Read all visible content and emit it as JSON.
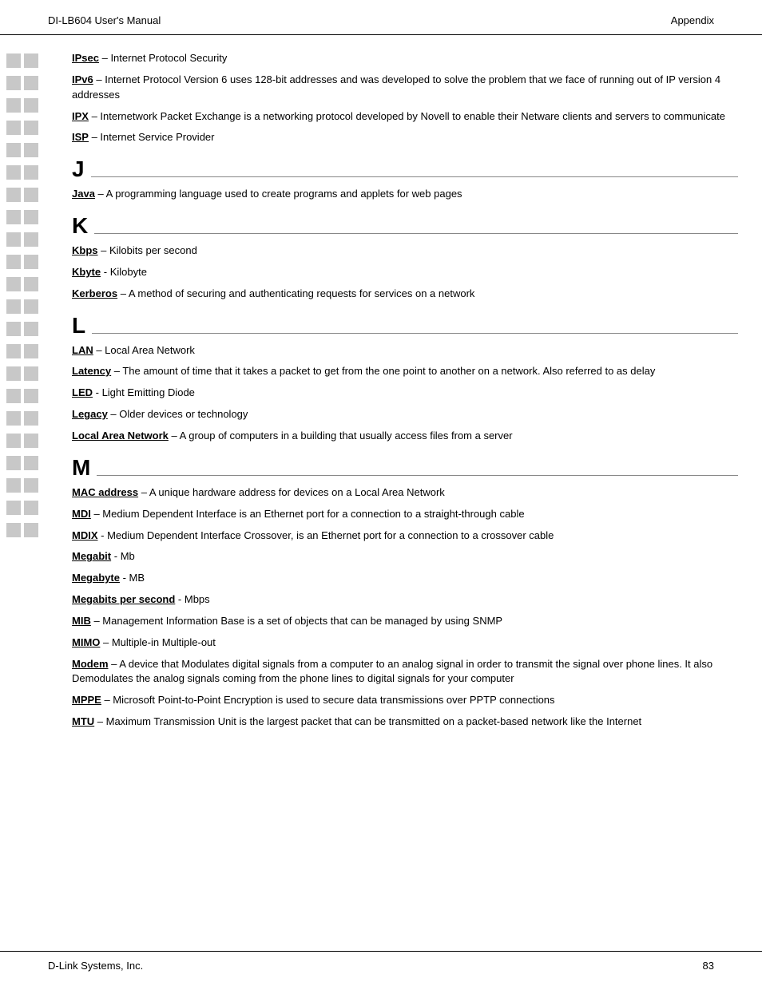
{
  "header": {
    "left": "DI-LB604 User's Manual",
    "right": "Appendix"
  },
  "footer": {
    "left": "D-Link Systems, Inc.",
    "right": "83"
  },
  "sidebar": {
    "blocks": [
      {
        "id": 1
      },
      {
        "id": 2
      },
      {
        "id": 3
      },
      {
        "id": 4
      },
      {
        "id": 5
      },
      {
        "id": 6
      },
      {
        "id": 7
      },
      {
        "id": 8
      },
      {
        "id": 9
      },
      {
        "id": 10
      },
      {
        "id": 11
      },
      {
        "id": 12
      },
      {
        "id": 13
      },
      {
        "id": 14
      },
      {
        "id": 15
      },
      {
        "id": 16
      },
      {
        "id": 17
      },
      {
        "id": 18
      },
      {
        "id": 19
      },
      {
        "id": 20
      },
      {
        "id": 21
      },
      {
        "id": 22
      }
    ]
  },
  "sections": [
    {
      "id": "I-section",
      "entries": [
        {
          "term": "IPsec",
          "dash": " –",
          "def": " Internet Protocol Security"
        },
        {
          "term": "IPv6",
          "dash": " –",
          "def": " Internet Protocol Version 6 uses 128-bit addresses and was developed to solve the problem that we face of running out of IP version 4 addresses"
        },
        {
          "term": "IPX",
          "dash": " –",
          "def": " Internetwork Packet Exchange is a networking protocol developed by Novell to enable their Netware clients and servers to communicate"
        },
        {
          "term": "ISP",
          "dash": " –",
          "def": " Internet Service Provider"
        }
      ]
    },
    {
      "id": "J-section",
      "letter": "J",
      "entries": [
        {
          "term": "Java",
          "dash": " –",
          "def": " A programming language used to create programs and applets for web pages"
        }
      ]
    },
    {
      "id": "K-section",
      "letter": "K",
      "entries": [
        {
          "term": "Kbps",
          "dash": " –",
          "def": " Kilobits per second"
        },
        {
          "term": "Kbyte",
          "dash": " -",
          "def": " Kilobyte"
        },
        {
          "term": "Kerberos",
          "dash": " –",
          "def": " A method of securing and authenticating requests for services on a network"
        }
      ]
    },
    {
      "id": "L-section",
      "letter": "L",
      "entries": [
        {
          "term": "LAN",
          "dash": " –",
          "def": " Local Area Network"
        },
        {
          "term": "Latency",
          "dash": " –",
          "def": " The amount of time that it takes a packet to get from the one point to another on a network.  Also referred to as delay"
        },
        {
          "term": "LED",
          "dash": "  -",
          "def": " Light Emitting Diode"
        },
        {
          "term": "Legacy",
          "dash": " –",
          "def": " Older devices or technology"
        },
        {
          "term": "Local Area Network",
          "dash": " –",
          "def": " A group of computers in a building that usually access files from a server"
        }
      ]
    },
    {
      "id": "M-section",
      "letter": "M",
      "entries": [
        {
          "term": "MAC address",
          "dash": " –",
          "def": " A unique hardware address for devices on a Local Area Network"
        },
        {
          "term": "MDI",
          "dash": " –",
          "def": " Medium Dependent Interface is an Ethernet port for a connection to a straight-through cable"
        },
        {
          "term": "MDIX",
          "dash": " -",
          "def": " Medium Dependent Interface Crossover, is an Ethernet port for a connection to a crossover cable"
        },
        {
          "term": "Megabit",
          "dash": " -",
          "def": " Mb"
        },
        {
          "term": "Megabyte",
          "dash": " -",
          "def": " MB"
        },
        {
          "term": "Megabits per second",
          "dash": " -",
          "def": " Mbps"
        },
        {
          "term": "MIB",
          "dash": " –",
          "def": " Management Information Base is a set of objects that can be managed by using SNMP"
        },
        {
          "term": "MIMO",
          "dash": " –",
          "def": " Multiple-in Multiple-out"
        },
        {
          "term": "Modem",
          "dash": " –",
          "def": " A device that Modulates digital signals from a computer to an analog signal in order to transmit the signal over phone lines.  It also Demodulates the analog signals coming from the phone lines to digital signals for your computer"
        },
        {
          "term": "MPPE",
          "dash": " –",
          "def": " Microsoft Point-to-Point Encryption is used to secure data transmissions over PPTP connections"
        },
        {
          "term": "MTU",
          "dash": " –",
          "def": " Maximum Transmission Unit is the largest packet that can be transmitted on a packet-based network like the Internet"
        }
      ]
    }
  ]
}
